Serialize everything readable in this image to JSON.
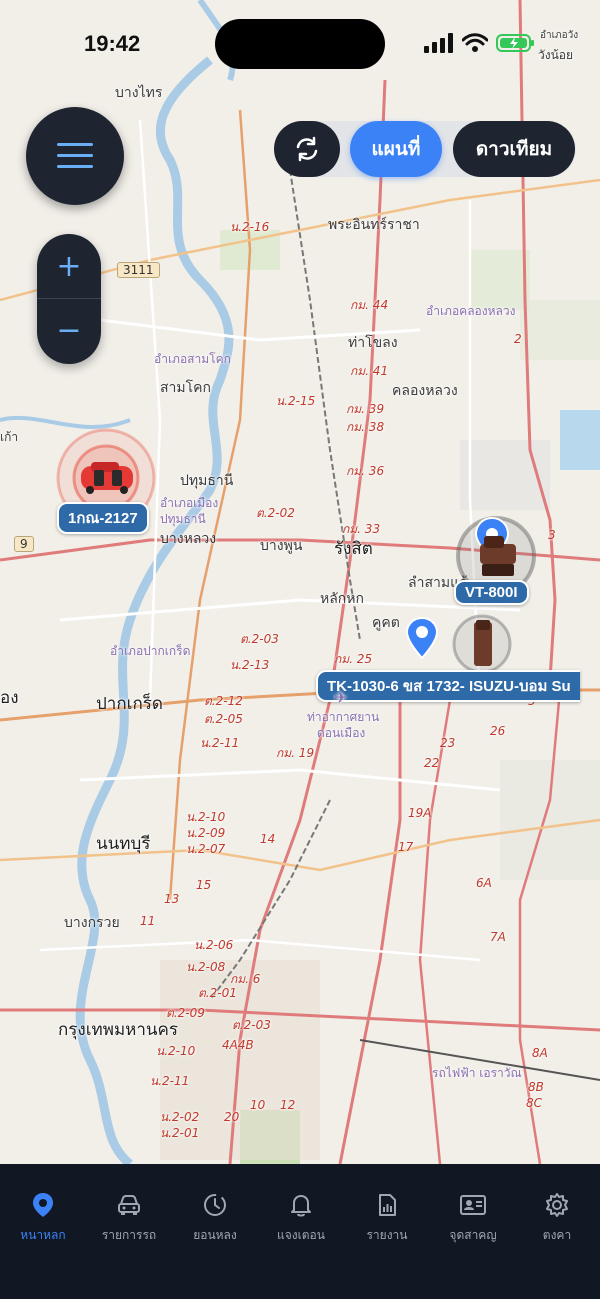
{
  "status_bar": {
    "time": "19:42"
  },
  "view_toggle": {
    "map_label": "แผนที่",
    "satellite_label": "ดาวเทียม"
  },
  "zoom": {
    "in_label": "+",
    "out_label": "−"
  },
  "map_labels": {
    "bang_khen_top": "บางไทร",
    "phra_in": "พระอินทร์ราชา",
    "amphoe_khlong_luang": "อำเภอคลองหลวง",
    "tham_khong": "ท่าโขลง",
    "khlong_luang": "คลองหลวง",
    "amphoe_sam_khok": "อำเภอสามโคก",
    "sam_khok": "สามโคก",
    "pathum_thani": "ปทุมธานี",
    "amphoe_mueang": "อำเภอเมือง",
    "pathum_thani2": "ปทุมธานี",
    "bang_luang": "บางหลวง",
    "bang_phun": "บางพูน",
    "rangsit": "รังสิต",
    "lak_hok": "หลักหก",
    "lam_sam_kaeo": "ลำสามแก้",
    "khu_khot": "คูคต",
    "amphoe_pak_kret": "อำเภอปากเกร็ด",
    "pak_kret": "ปากเกร็ด",
    "don_mueang": "ท่าอากาศยาน",
    "don_mueang2": "ดอนเมือง",
    "nonthaburi": "นนทบุรี",
    "bang_kruai": "บางกรวย",
    "bangkok": "กรุงเทพมหานคร",
    "wang_noi": "วังน้อย",
    "wang_noi_top": "อำเภอวัง",
    "ong": "อง",
    "kao": "เก้า",
    "rot_fai": "รถไฟฟ้า เอราวัณ",
    "shield_3111": "3111",
    "shield_9": "9",
    "r_n216": "น.2-16",
    "r_km44": "กม. 44",
    "r_km41": "กม. 41",
    "r_n215": "น.2-15",
    "r_km39": "กม. 39",
    "r_km38": "กม. 38",
    "r_km36": "กม. 36",
    "r_km33": "กม. 33",
    "r_t202": "ต.2-02",
    "r_t203": "ต.2-03",
    "r_n213": "น.2-13",
    "r_km25": "กม. 25",
    "r_t212": "ต.2-12",
    "r_t205": "ต.2-05",
    "r_n211": "น.2-11",
    "r_km19": "กม. 19",
    "r_n210": "น.2-10",
    "r_n209": "น.2-09",
    "r_n207": "น.2-07",
    "r_14": "14",
    "r_23": "23",
    "r_22": "22",
    "r_26": "26",
    "r_19a": "19A",
    "r_17": "17",
    "r_5": "5",
    "r_2": "2",
    "r_3": "3",
    "r_6a": "6A",
    "r_7a": "7A",
    "r_8a": "8A",
    "r_8b": "8B",
    "r_8c": "8C",
    "r_15": "15",
    "r_13": "13",
    "r_11": "11",
    "r_12": "12",
    "r_20": "20",
    "r_10": "10",
    "r_4a4b": "4A4B",
    "r_n206": "น.2-06",
    "r_n208": "น.2-08",
    "r_t201": "ต.2-01",
    "r_t209": "ต.2-09",
    "r_t203b": "ต.2-03",
    "r_n210b": "น.2-10",
    "r_n211b": "น.2-11",
    "r_n202": "น.2-02",
    "r_n201": "น.2-01",
    "r_km6": "กม. 6"
  },
  "vehicles": [
    {
      "plate": "1กณ-2127",
      "color": "#e53935"
    },
    {
      "plate": "VT-800I",
      "color": "#6d3b2a"
    },
    {
      "plate": "TK-1030-6 ขส 1732- ISUZU-บอม Su",
      "color": "#6d3b2a"
    }
  ],
  "tabs": [
    {
      "label": "หนาหลก",
      "icon": "map-pin-icon",
      "active": true
    },
    {
      "label": "รายการรถ",
      "icon": "car-icon",
      "active": false
    },
    {
      "label": "ยอนหลง",
      "icon": "history-icon",
      "active": false
    },
    {
      "label": "แจงเตอน",
      "icon": "bell-icon",
      "active": false
    },
    {
      "label": "รายงาน",
      "icon": "report-icon",
      "active": false
    },
    {
      "label": "จุดสาคญ",
      "icon": "id-card-icon",
      "active": false
    },
    {
      "label": "ตงคา",
      "icon": "gear-icon",
      "active": false
    }
  ],
  "colors": {
    "accent": "#3b82f6",
    "dark_panel": "#1e2530",
    "tabbar": "#111823"
  }
}
